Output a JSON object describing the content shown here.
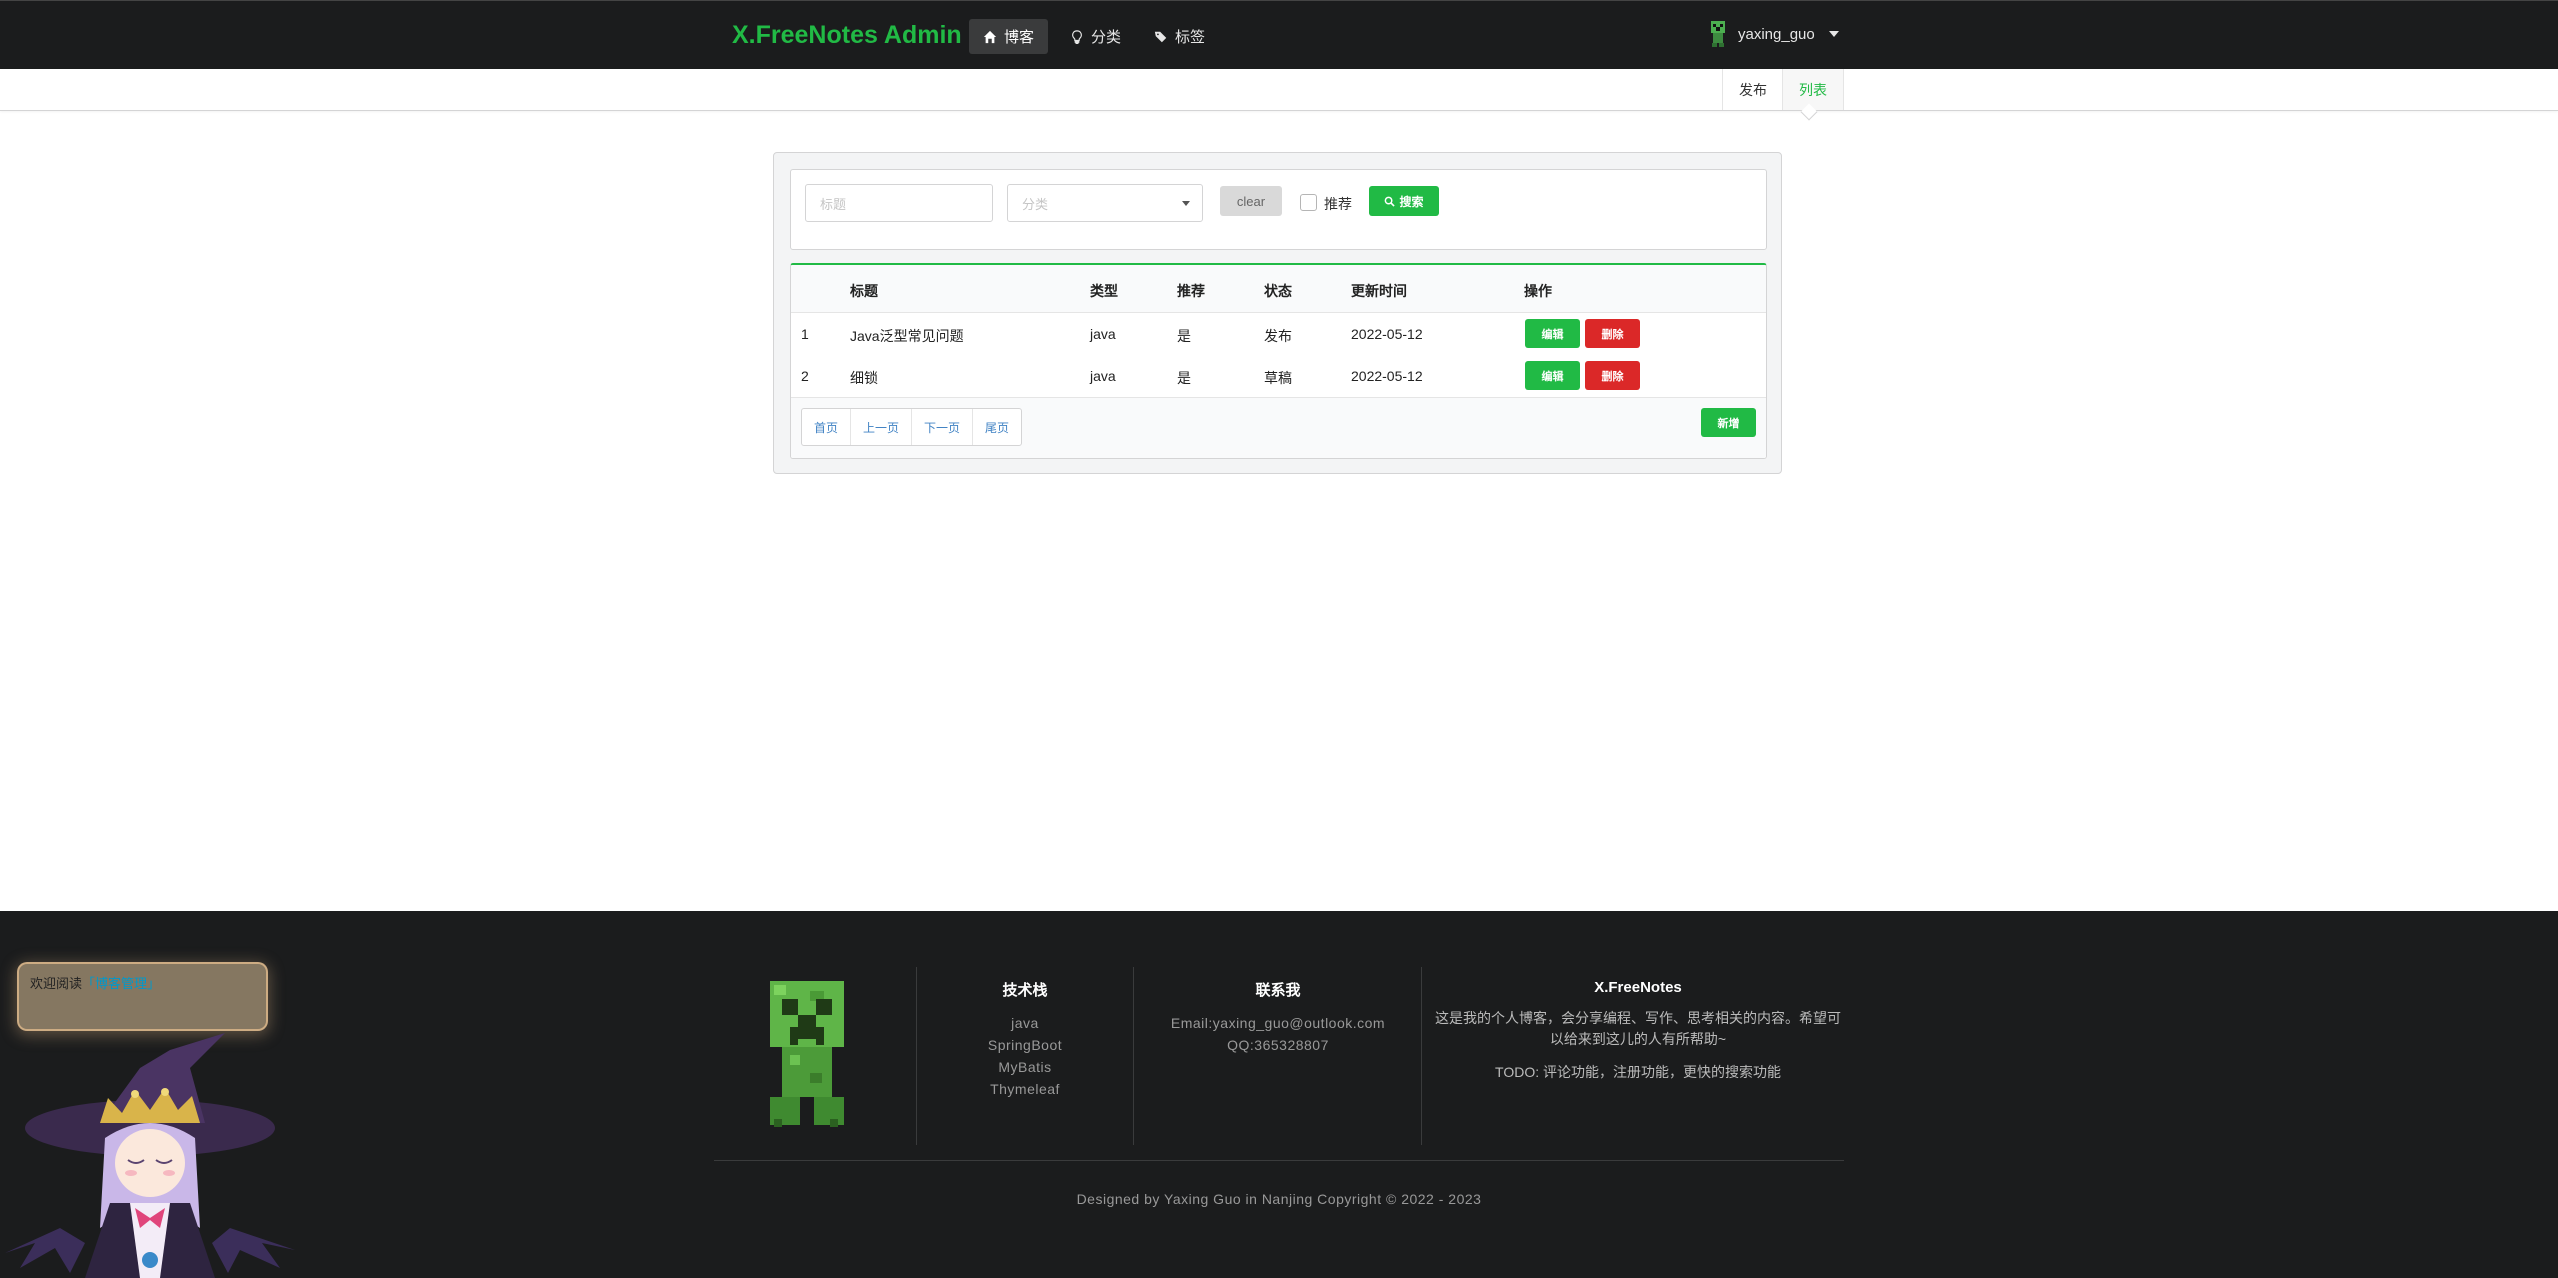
{
  "header": {
    "brand": "X.FreeNotes Admin",
    "nav": [
      {
        "label": "博客",
        "icon": "home-icon",
        "active": true
      },
      {
        "label": "分类",
        "icon": "lightbulb-icon",
        "active": false
      },
      {
        "label": "标签",
        "icon": "tags-icon",
        "active": false
      }
    ],
    "user": {
      "name": "yaxing_guo",
      "avatar": "creeper-avatar"
    }
  },
  "submenu": {
    "publish": "发布",
    "list": "列表"
  },
  "search": {
    "title_placeholder": "标题",
    "category_placeholder": "分类",
    "clear_label": "clear",
    "recommend_label": "推荐",
    "search_label": "搜索"
  },
  "table": {
    "columns": [
      "",
      "标题",
      "类型",
      "推荐",
      "状态",
      "更新时间",
      "操作"
    ],
    "rows": [
      {
        "id": "1",
        "title": "Java泛型常见问题",
        "type": "java",
        "recommend": "是",
        "status": "发布",
        "updated": "2022-05-12",
        "edit": "编辑",
        "delete": "删除"
      },
      {
        "id": "2",
        "title": "细锁",
        "type": "java",
        "recommend": "是",
        "status": "草稿",
        "updated": "2022-05-12",
        "edit": "编辑",
        "delete": "删除"
      }
    ],
    "pager": [
      "首页",
      "上一页",
      "下一页",
      "尾页"
    ],
    "new_label": "新增"
  },
  "footer": {
    "tech": {
      "title": "技术栈",
      "items": [
        "java",
        "SpringBoot",
        "MyBatis",
        "Thymeleaf"
      ]
    },
    "contact": {
      "title": "联系我",
      "email": "Email:yaxing_guo@outlook.com",
      "qq": "QQ:365328807"
    },
    "about": {
      "title": "X.FreeNotes",
      "desc": "这是我的个人博客，会分享编程、写作、思考相关的内容。希望可以给来到这儿的人有所帮助~",
      "todo": "TODO: 评论功能，注册功能，更快的搜索功能"
    },
    "copyright": "Designed by Yaxing Guo in Nanjing Copyright © 2022 - 2023"
  },
  "widget": {
    "greeting": "欢迎阅读",
    "highlight": "「博客管理」"
  },
  "colors": {
    "accent": "#21ba45",
    "danger": "#db2828",
    "dark": "#1b1c1d"
  }
}
